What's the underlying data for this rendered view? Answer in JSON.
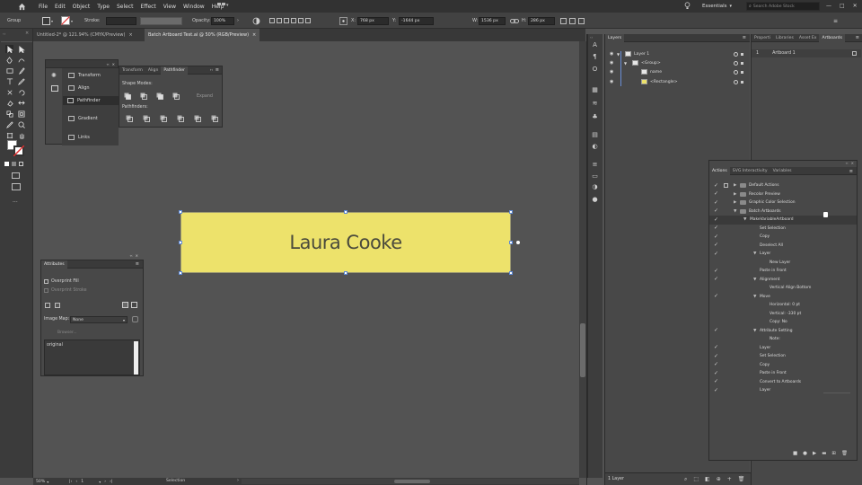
{
  "menubar": {
    "items": [
      "File",
      "Edit",
      "Object",
      "Type",
      "Select",
      "Effect",
      "View",
      "Window",
      "Help"
    ],
    "workspace": "Essentials",
    "search_placeholder": "Search Adobe Stock"
  },
  "controlbar": {
    "selection_label": "Group",
    "stroke_label": "Stroke:",
    "opacity_label": "Opacity:",
    "opacity_value": "100%",
    "x_label": "X:",
    "x_value": "768 px",
    "y_label": "Y:",
    "y_value": "-1644 px",
    "w_label": "W:",
    "w_value": "1536 px",
    "h_label": "H:",
    "h_value": "286 px"
  },
  "tabs": [
    {
      "label": "Untitled-2* @ 121.94% (CMYK/Preview)",
      "active": false
    },
    {
      "label": "Batch Artboard Test.ai @ 50% (RGB/Preview)",
      "active": true
    }
  ],
  "artboard": {
    "text": "Laura Cooke",
    "fill": "#ede26b"
  },
  "transform_panel": {
    "items": [
      "Transform",
      "Align",
      "Pathfinder",
      "Gradient",
      "Links"
    ]
  },
  "pathfinder_panel": {
    "tabs": [
      "Transform",
      "Align",
      "Pathfinder"
    ],
    "shape_modes_label": "Shape Modes:",
    "expand_label": "Expand",
    "pathfinders_label": "Pathfinders:"
  },
  "attributes_panel": {
    "title": "Attributes",
    "overprint_fill": "Overprint Fill",
    "overprint_stroke": "Overprint Stroke",
    "image_map_label": "Image Map:",
    "image_map_value": "None",
    "browser_label": "Browser...",
    "note_text": "original"
  },
  "layers_panel": {
    "title": "Layers",
    "rows": [
      "Layer 1",
      "<Group>",
      "name",
      "<Rectangle>"
    ],
    "footer": "1 Layer"
  },
  "props_panel": {
    "tabs": [
      "Properti",
      "Libraries",
      "Asset Ex",
      "Artboards"
    ],
    "artboard_index": "1",
    "artboard_name": "Artboard 1"
  },
  "actions_panel": {
    "tabs": [
      "Actions",
      "SVG Interactivity",
      "Variables"
    ],
    "rows": [
      {
        "label": "Default Actions",
        "indent": 0,
        "folder": true,
        "tri": "▶",
        "chk": true,
        "dialog": true
      },
      {
        "label": "Recolor Preview",
        "indent": 0,
        "folder": true,
        "tri": "▶",
        "chk": true,
        "dialog": false
      },
      {
        "label": "Graphic Color Selection",
        "indent": 0,
        "folder": true,
        "tri": "▶",
        "chk": true,
        "dialog": false
      },
      {
        "label": "Batch Artboards",
        "indent": 0,
        "folder": true,
        "tri": "▼",
        "chk": true,
        "dialog": false
      },
      {
        "label": "MakeVariableArtboard",
        "indent": 1,
        "folder": false,
        "tri": "▼",
        "chk": true,
        "dialog": false,
        "selected": true
      },
      {
        "label": "Set Selection",
        "indent": 2,
        "folder": false,
        "tri": "",
        "chk": true,
        "dialog": false
      },
      {
        "label": "Copy",
        "indent": 2,
        "folder": false,
        "tri": "",
        "chk": true,
        "dialog": false
      },
      {
        "label": "Deselect All",
        "indent": 2,
        "folder": false,
        "tri": "",
        "chk": true,
        "dialog": false
      },
      {
        "label": "Layer",
        "indent": 2,
        "folder": false,
        "tri": "▼",
        "chk": true,
        "dialog": false
      },
      {
        "label": "New Layer",
        "indent": 3,
        "folder": false,
        "tri": "",
        "chk": false,
        "dialog": false
      },
      {
        "label": "Paste in Front",
        "indent": 2,
        "folder": false,
        "tri": "",
        "chk": true,
        "dialog": false
      },
      {
        "label": "Alignment",
        "indent": 2,
        "folder": false,
        "tri": "▼",
        "chk": true,
        "dialog": false
      },
      {
        "label": "Vertical Align Bottom",
        "indent": 3,
        "folder": false,
        "tri": "",
        "chk": false,
        "dialog": false
      },
      {
        "label": "Move",
        "indent": 2,
        "folder": false,
        "tri": "▼",
        "chk": true,
        "dialog": false
      },
      {
        "label": "Horizontal: 0 pt",
        "indent": 3,
        "folder": false,
        "tri": "",
        "chk": false,
        "dialog": false
      },
      {
        "label": "Vertical: -330 pt",
        "indent": 3,
        "folder": false,
        "tri": "",
        "chk": false,
        "dialog": false
      },
      {
        "label": "Copy: No",
        "indent": 3,
        "folder": false,
        "tri": "",
        "chk": false,
        "dialog": false
      },
      {
        "label": "Attribute Setting",
        "indent": 2,
        "folder": false,
        "tri": "▼",
        "chk": true,
        "dialog": false
      },
      {
        "label": "Note:",
        "indent": 3,
        "folder": false,
        "tri": "",
        "chk": false,
        "dialog": false
      },
      {
        "label": "Layer",
        "indent": 2,
        "folder": false,
        "tri": "",
        "chk": true,
        "dialog": false
      },
      {
        "label": "Set Selection",
        "indent": 2,
        "folder": false,
        "tri": "",
        "chk": true,
        "dialog": false
      },
      {
        "label": "Copy",
        "indent": 2,
        "folder": false,
        "tri": "",
        "chk": true,
        "dialog": false
      },
      {
        "label": "Paste in Front",
        "indent": 2,
        "folder": false,
        "tri": "",
        "chk": true,
        "dialog": false
      },
      {
        "label": "Convert to Artboards",
        "indent": 2,
        "folder": false,
        "tri": "",
        "chk": true,
        "dialog": false
      },
      {
        "label": "Layer",
        "indent": 2,
        "folder": false,
        "tri": "",
        "chk": true,
        "dialog": false
      }
    ]
  },
  "statusbar": {
    "zoom": "50%",
    "artboard_nav": "1",
    "tool_name": "Selection"
  }
}
